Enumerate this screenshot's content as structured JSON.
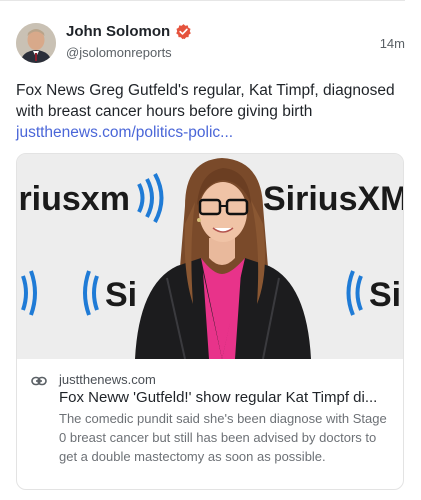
{
  "post": {
    "author": "John Solomon",
    "handle": "@jsolomonreports",
    "time": "14m",
    "text": "Fox News Greg Gutfeld's regular, Kat Timpf, diagnosed with breast cancer hours before giving birth ",
    "link_text": "justthenews.com/politics-polic..."
  },
  "card": {
    "domain": "justthenews.com",
    "title": "Fox Neww 'Gutfeld!' show regular Kat Timpf di...",
    "description": "The comedic pundit said she's been diagnose with Stage 0 breast cancer but still has been advised by doctors to get a double mastectomy as soon as possible.",
    "image_logo_text": [
      "iriusxm",
      "SiriusXM",
      "Si",
      "Si"
    ]
  },
  "icons": {
    "verified": "verified-badge-icon",
    "link": "link-icon"
  },
  "colors": {
    "verified": "#e5533d",
    "link": "#4a66d8",
    "sirius_blue": "#1f7bd6"
  }
}
